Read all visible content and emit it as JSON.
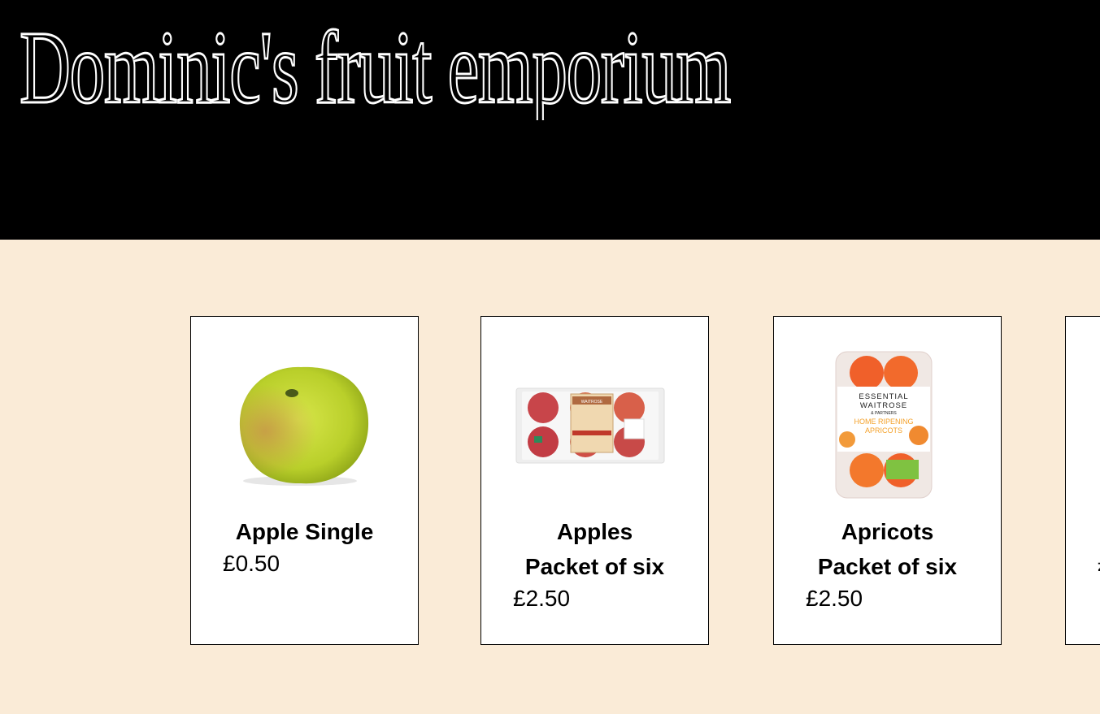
{
  "site": {
    "title": "Dominic's fruit  emporium"
  },
  "products": [
    {
      "name": "Apple Single",
      "price": "£0.50",
      "image": "green-apple"
    },
    {
      "name": "Apples\nPacket of six",
      "price": "£2.50",
      "image": "apples-pack"
    },
    {
      "name": "Apricots\nPacket of six",
      "price": "£2.50",
      "image": "apricots-pack"
    },
    {
      "name": "",
      "price": "£",
      "image": ""
    }
  ],
  "apricot_pack_label": {
    "line1": "ESSENTIAL",
    "line2": "WAITROSE",
    "line3": "& PARTNERS",
    "line4": "HOME RIPENING",
    "line5": "APRICOTS"
  },
  "apple_pack_label": {
    "brand": "WAITROSE"
  },
  "colors": {
    "header_bg": "#000000",
    "page_bg": "#faebd7",
    "card_bg": "#ffffff"
  }
}
